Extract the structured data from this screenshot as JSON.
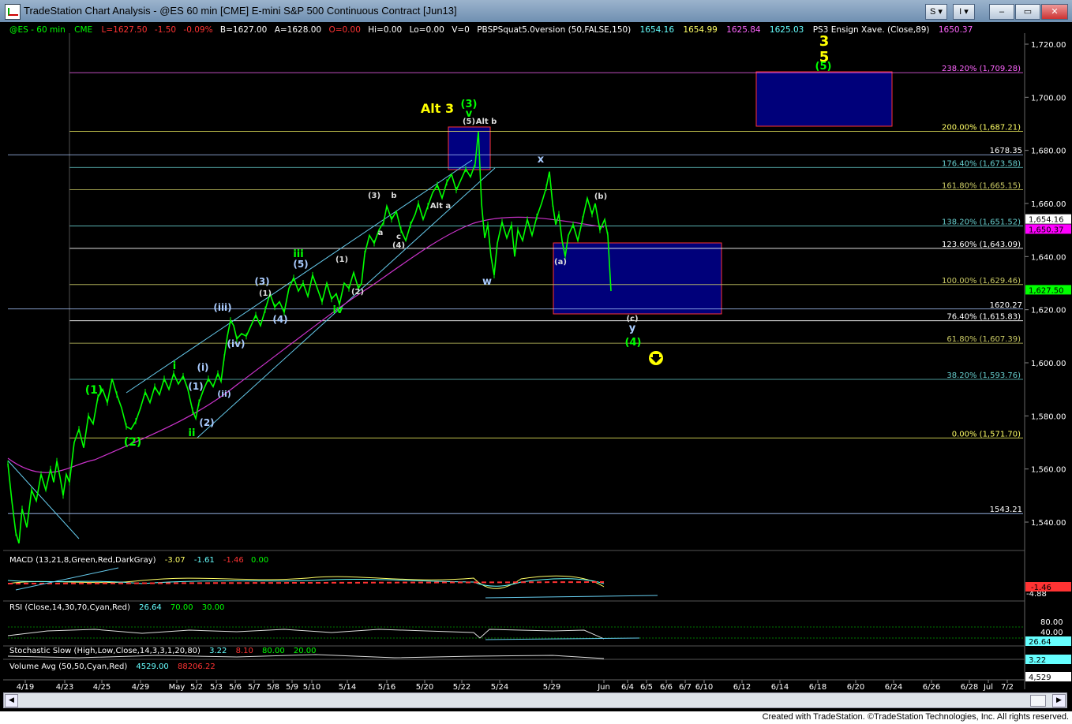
{
  "window": {
    "title": "TradeStation Chart Analysis - @ES 60 min [CME] E-mini S&P 500 Continuous Contract [Jun13]",
    "btn_s": "S",
    "btn_i": "I"
  },
  "footer": {
    "credit": "Created with TradeStation. ©TradeStation Technologies, Inc. All rights reserved."
  },
  "header": {
    "sym": "@ES - 60 min",
    "exch": "CME",
    "last": "L=1627.50",
    "chg": "-1.50",
    "pct": "-0.09%",
    "bid": "B=1627.00",
    "ask": "A=1628.00",
    "open": "O=0.00",
    "hi": "Hi=0.00",
    "lo": "Lo=0.00",
    "vol": "V=0",
    "pbs": "PBSPSquat5.0version (50,FALSE,150)",
    "pbs_v1": "1654.16",
    "pbs_v2": "1654.99",
    "pbs_v3": "1625.84",
    "pbs_v4": "1625.03",
    "ps3": "PS3 Ensign Xave. (Close,89)",
    "ps3_v": "1650.37"
  },
  "macd": {
    "label": "MACD (13,21,8,Green,Red,DarkGray)",
    "v1": "-3.07",
    "v2": "-1.61",
    "v3": "-1.46",
    "v4": "0.00",
    "axis1": "-4.88",
    "tag": "-1.46"
  },
  "rsi": {
    "label": "RSI (Close,14,30,70,Cyan,Red)",
    "v1": "26.64",
    "v2": "70.00",
    "v3": "30.00",
    "axis1": "80.00",
    "axis2": "40.00",
    "tag": "26.64"
  },
  "stoch": {
    "label": "Stochastic Slow (High,Low,Close,14,3,3,1,20,80)",
    "v1": "3.22",
    "v2": "8.10",
    "v3": "80.00",
    "v4": "20.00",
    "tag": "3.22"
  },
  "volume": {
    "label": "Volume Avg (50,50,Cyan,Red)",
    "v1": "4529.00",
    "v2": "88206.22",
    "tag": "4,529"
  },
  "colors": {
    "green": "#00ff00",
    "yellow": "#ffff00",
    "magenta": "#ff00ff",
    "cyan": "#00ffff",
    "box": "#00007a"
  },
  "chart_data": {
    "type": "line",
    "title": "@ES 60 min E-mini S&P 500",
    "ylim": [
      1525,
      1730
    ],
    "y_ticks": [
      "1,540.00",
      "1,560.00",
      "1,580.00",
      "1,600.00",
      "1,620.00",
      "1,640.00",
      "1,660.00",
      "1,680.00",
      "1,700.00",
      "1,720.00"
    ],
    "x_ticks": [
      "4/19",
      "4/23",
      "4/25",
      "4/29",
      "May",
      "5/2",
      "5/3",
      "5/6",
      "5/7",
      "5/8",
      "5/9",
      "5/10",
      "5/14",
      "5/16",
      "5/20",
      "5/22",
      "5/24",
      "5/29",
      "Jun",
      "6/4",
      "6/5",
      "6/6",
      "6/7",
      "6/10",
      "6/12",
      "6/14",
      "6/18",
      "6/20",
      "6/24",
      "6/26",
      "6/28",
      "Jul",
      "7/2"
    ],
    "fib_levels": [
      {
        "label": "238.20% (1,709.28)",
        "value": 1709.28,
        "color": "#ff66ff"
      },
      {
        "label": "200.00% (1,687.21)",
        "value": 1687.21,
        "color": "#ffff66"
      },
      {
        "label": "176.40% (1,673.58)",
        "value": 1673.58,
        "color": "#66cccc"
      },
      {
        "label": "161.80% (1,665.15)",
        "value": 1665.15,
        "color": "#cccc66"
      },
      {
        "label": "138.20% (1,651.52)",
        "value": 1651.52,
        "color": "#66cccc"
      },
      {
        "label": "123.60% (1,643.09)",
        "value": 1643.09,
        "color": "#ffffff"
      },
      {
        "label": "100.00% (1,629.46)",
        "value": 1629.46,
        "color": "#cccc66"
      },
      {
        "label": "76.40% (1,615.83)",
        "value": 1615.83,
        "color": "#ffffff"
      },
      {
        "label": "61.80% (1,607.39)",
        "value": 1607.39,
        "color": "#cccc66"
      },
      {
        "label": "38.20% (1,593.76)",
        "value": 1593.76,
        "color": "#66cccc"
      },
      {
        "label": "0.00% (1,571.70)",
        "value": 1571.7,
        "color": "#ffff66"
      }
    ],
    "h_levels": [
      {
        "label": "1678.35",
        "value": 1678.35
      },
      {
        "label": "1620.27",
        "value": 1620.27
      },
      {
        "label": "1543.21",
        "value": 1543.21
      }
    ],
    "price_tags": [
      {
        "label": "1,654.16",
        "value": 1654.16,
        "bg": "#ffffff",
        "fg": "#000000"
      },
      {
        "label": "1,650.37",
        "value": 1650.37,
        "bg": "#ff00ff",
        "fg": "#000000"
      },
      {
        "label": "1,627.50",
        "value": 1627.5,
        "bg": "#00ff00",
        "fg": "#000000"
      }
    ],
    "series": [
      {
        "color": "#00ff00",
        "values": [
          [
            0,
            1562
          ],
          [
            5,
            1548
          ],
          [
            10,
            1536
          ],
          [
            14,
            1532
          ],
          [
            18,
            1545
          ],
          [
            24,
            1538
          ],
          [
            30,
            1552
          ],
          [
            36,
            1548
          ],
          [
            42,
            1558
          ],
          [
            48,
            1552
          ],
          [
            54,
            1560
          ],
          [
            58,
            1555
          ],
          [
            62,
            1563
          ],
          [
            66,
            1557
          ],
          [
            70,
            1550
          ],
          [
            74,
            1558
          ],
          [
            78,
            1555
          ],
          [
            84,
            1570
          ],
          [
            90,
            1575
          ],
          [
            96,
            1568
          ],
          [
            102,
            1580
          ],
          [
            108,
            1577
          ],
          [
            114,
            1587
          ],
          [
            120,
            1590
          ],
          [
            126,
            1585
          ],
          [
            132,
            1594
          ],
          [
            138,
            1588
          ],
          [
            144,
            1583
          ],
          [
            150,
            1576
          ],
          [
            156,
            1575
          ],
          [
            162,
            1578
          ],
          [
            168,
            1583
          ],
          [
            174,
            1589
          ],
          [
            180,
            1585
          ],
          [
            186,
            1591
          ],
          [
            192,
            1588
          ],
          [
            198,
            1594
          ],
          [
            204,
            1590
          ],
          [
            210,
            1596
          ],
          [
            216,
            1592
          ],
          [
            222,
            1595
          ],
          [
            228,
            1590
          ],
          [
            234,
            1582
          ],
          [
            238,
            1579
          ],
          [
            242,
            1585
          ],
          [
            248,
            1590
          ],
          [
            254,
            1594
          ],
          [
            260,
            1591
          ],
          [
            266,
            1596
          ],
          [
            270,
            1593
          ],
          [
            274,
            1602
          ],
          [
            278,
            1610
          ],
          [
            282,
            1616
          ],
          [
            286,
            1614
          ],
          [
            290,
            1609
          ],
          [
            296,
            1611
          ],
          [
            302,
            1610
          ],
          [
            308,
            1614
          ],
          [
            314,
            1618
          ],
          [
            320,
            1614
          ],
          [
            326,
            1620
          ],
          [
            332,
            1626
          ],
          [
            338,
            1621
          ],
          [
            344,
            1623
          ],
          [
            350,
            1619
          ],
          [
            356,
            1628
          ],
          [
            362,
            1632
          ],
          [
            368,
            1627
          ],
          [
            374,
            1630
          ],
          [
            380,
            1625
          ],
          [
            386,
            1633
          ],
          [
            392,
            1628
          ],
          [
            398,
            1623
          ],
          [
            404,
            1630
          ],
          [
            410,
            1624
          ],
          [
            416,
            1626
          ],
          [
            420,
            1622
          ],
          [
            426,
            1630
          ],
          [
            432,
            1628
          ],
          [
            438,
            1634
          ],
          [
            444,
            1628
          ],
          [
            448,
            1630
          ],
          [
            452,
            1641
          ],
          [
            458,
            1648
          ],
          [
            464,
            1645
          ],
          [
            470,
            1650
          ],
          [
            476,
            1653
          ],
          [
            480,
            1659
          ],
          [
            486,
            1654
          ],
          [
            492,
            1657
          ],
          [
            498,
            1650
          ],
          [
            504,
            1646
          ],
          [
            510,
            1652
          ],
          [
            516,
            1656
          ],
          [
            520,
            1660
          ],
          [
            526,
            1654
          ],
          [
            532,
            1659
          ],
          [
            538,
            1664
          ],
          [
            544,
            1667
          ],
          [
            550,
            1662
          ],
          [
            556,
            1668
          ],
          [
            562,
            1671
          ],
          [
            568,
            1665
          ],
          [
            574,
            1669
          ],
          [
            580,
            1673
          ],
          [
            586,
            1670
          ],
          [
            592,
            1675
          ],
          [
            596,
            1687
          ],
          [
            600,
            1660
          ],
          [
            604,
            1647
          ],
          [
            608,
            1652
          ],
          [
            612,
            1640
          ],
          [
            616,
            1633
          ],
          [
            620,
            1645
          ],
          [
            626,
            1653
          ],
          [
            632,
            1647
          ],
          [
            638,
            1652
          ],
          [
            642,
            1640
          ],
          [
            646,
            1650
          ],
          [
            652,
            1646
          ],
          [
            658,
            1654
          ],
          [
            664,
            1648
          ],
          [
            670,
            1655
          ],
          [
            676,
            1660
          ],
          [
            682,
            1666
          ],
          [
            686,
            1672
          ],
          [
            690,
            1660
          ],
          [
            694,
            1652
          ],
          [
            698,
            1656
          ],
          [
            702,
            1646
          ],
          [
            706,
            1640
          ],
          [
            710,
            1648
          ],
          [
            716,
            1652
          ],
          [
            722,
            1646
          ],
          [
            728,
            1654
          ],
          [
            734,
            1662
          ],
          [
            740,
            1656
          ],
          [
            744,
            1660
          ],
          [
            750,
            1650
          ],
          [
            756,
            1654
          ],
          [
            760,
            1648
          ],
          [
            764,
            1627
          ]
        ]
      }
    ],
    "annotations": [
      {
        "text": "3",
        "x": 1044,
        "y": 58,
        "color": "#ffff00",
        "size": 18
      },
      {
        "text": "5",
        "x": 1044,
        "y": 78,
        "color": "#ffff00",
        "size": 18
      },
      {
        "text": "(5)",
        "x": 1043,
        "y": 88,
        "color": "#00ff00",
        "size": 13
      },
      {
        "text": "Alt 3",
        "x": 554,
        "y": 143,
        "color": "#ffff00",
        "size": 16
      },
      {
        "text": "(3)",
        "x": 594,
        "y": 136,
        "color": "#00ff00",
        "size": 13
      },
      {
        "text": "v",
        "x": 594,
        "y": 148,
        "color": "#00ff00",
        "size": 13
      },
      {
        "text": "(5)",
        "x": 594,
        "y": 157,
        "color": "#dddddd",
        "size": 10
      },
      {
        "text": "Alt b",
        "x": 616,
        "y": 157,
        "color": "#dddddd",
        "size": 10
      },
      {
        "text": "x",
        "x": 685,
        "y": 206,
        "color": "#aaccff",
        "size": 13
      },
      {
        "text": "(b)",
        "x": 761,
        "y": 252,
        "color": "#dddddd",
        "size": 10
      },
      {
        "text": "(a)",
        "x": 710,
        "y": 335,
        "color": "#dddddd",
        "size": 10
      },
      {
        "text": "w",
        "x": 617,
        "y": 361,
        "color": "#aaccff",
        "size": 13
      },
      {
        "text": "(c)",
        "x": 801,
        "y": 407,
        "color": "#dddddd",
        "size": 10
      },
      {
        "text": "y",
        "x": 801,
        "y": 420,
        "color": "#aaccff",
        "size": 13
      },
      {
        "text": "(4)",
        "x": 802,
        "y": 438,
        "color": "#00ff00",
        "size": 13
      },
      {
        "text": "(3)",
        "x": 474,
        "y": 251,
        "color": "#dddddd",
        "size": 10
      },
      {
        "text": "b",
        "x": 499,
        "y": 251,
        "color": "#dddddd",
        "size": 10
      },
      {
        "text": "a",
        "x": 482,
        "y": 298,
        "color": "#dddddd",
        "size": 10
      },
      {
        "text": "c",
        "x": 505,
        "y": 303,
        "color": "#dddddd",
        "size": 10
      },
      {
        "text": "(4)",
        "x": 505,
        "y": 314,
        "color": "#dddddd",
        "size": 10
      },
      {
        "text": "Alt a",
        "x": 558,
        "y": 264,
        "color": "#dddddd",
        "size": 10
      },
      {
        "text": "(1)",
        "x": 433,
        "y": 332,
        "color": "#dddddd",
        "size": 10
      },
      {
        "text": "(2)",
        "x": 453,
        "y": 373,
        "color": "#dddddd",
        "size": 10
      },
      {
        "text": "iii",
        "x": 378,
        "y": 326,
        "color": "#00ff00",
        "size": 13
      },
      {
        "text": "(5)",
        "x": 381,
        "y": 339,
        "color": "#aaccff",
        "size": 12
      },
      {
        "text": "(3)",
        "x": 332,
        "y": 361,
        "color": "#aaccff",
        "size": 12
      },
      {
        "text": "(1)",
        "x": 336,
        "y": 375,
        "color": "#dddddd",
        "size": 10
      },
      {
        "text": "(4)",
        "x": 355,
        "y": 409,
        "color": "#aaccff",
        "size": 12
      },
      {
        "text": "iv",
        "x": 428,
        "y": 397,
        "color": "#00ff00",
        "size": 13
      },
      {
        "text": "(iii)",
        "x": 282,
        "y": 394,
        "color": "#aaccff",
        "size": 12
      },
      {
        "text": "(iv)",
        "x": 299,
        "y": 440,
        "color": "#aaccff",
        "size": 12
      },
      {
        "text": "i",
        "x": 221,
        "y": 468,
        "color": "#00ff00",
        "size": 13
      },
      {
        "text": "(i)",
        "x": 257,
        "y": 470,
        "color": "#aaccff",
        "size": 12
      },
      {
        "text": "(1)",
        "x": 248,
        "y": 494,
        "color": "#aaccff",
        "size": 12
      },
      {
        "text": "(ii)",
        "x": 284,
        "y": 503,
        "color": "#aaccff",
        "size": 11
      },
      {
        "text": "(2)",
        "x": 262,
        "y": 540,
        "color": "#aaccff",
        "size": 12
      },
      {
        "text": "ii",
        "x": 243,
        "y": 553,
        "color": "#00ff00",
        "size": 13
      },
      {
        "text": "(1)",
        "x": 119,
        "y": 499,
        "color": "#00ff00",
        "size": 14
      },
      {
        "text": "(2)",
        "x": 168,
        "y": 565,
        "color": "#00ff00",
        "size": 14
      }
    ]
  }
}
